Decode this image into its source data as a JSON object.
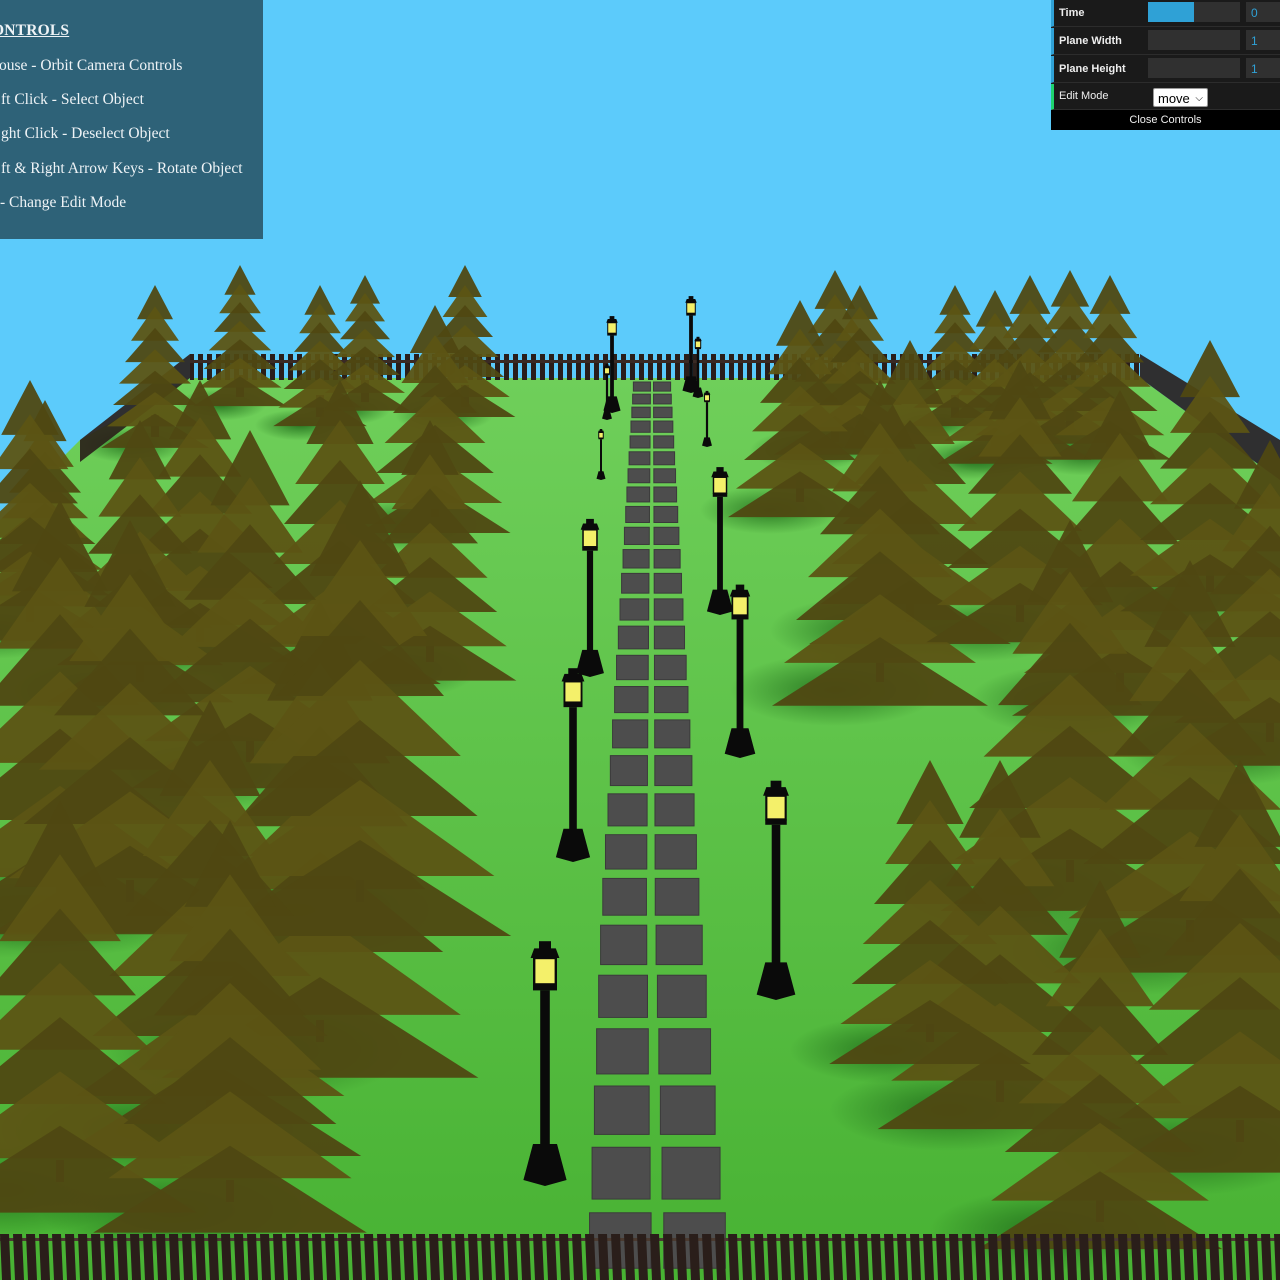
{
  "instructions": {
    "title": "CONTROLS",
    "lines": [
      "Mouse - Orbit Camera Controls",
      "Left Click - Select Object",
      "Right Click - Deselect Object",
      "Left & Right Arrow Keys - Rotate Object",
      "E - Change Edit Mode"
    ],
    "visible_title": "ONTROLS",
    "visible_lines": [
      "ouse - Orbit Camera Controls",
      "ft Click - Select Object",
      "ght Click - Deselect Object",
      "ft & Right Arrow Keys - Rotate Object",
      "- Change Edit Mode"
    ]
  },
  "gui": {
    "controllers": [
      {
        "label": "Time",
        "value": "0",
        "slider_fraction": 0.5,
        "type": "slider"
      },
      {
        "label": "Plane Width",
        "value": "1",
        "slider_fraction": 0.0,
        "type": "slider"
      },
      {
        "label": "Plane Height",
        "value": "1",
        "slider_fraction": 0.0,
        "type": "slider"
      }
    ],
    "edit_mode": {
      "label": "Edit Mode",
      "value": "move",
      "chevron": "chevron-down-icon"
    },
    "close_label": "Close Controls"
  },
  "scene": {
    "sky_color": "#5ccbfb",
    "grass_color": "#4fb83a",
    "tree_color": "#5c5414",
    "path_tile_color": "#4d4d4d",
    "lamp_color": "#0a0a0a",
    "lamp_light_color": "#f4f06a",
    "fence_color": "#2a1e1a"
  }
}
